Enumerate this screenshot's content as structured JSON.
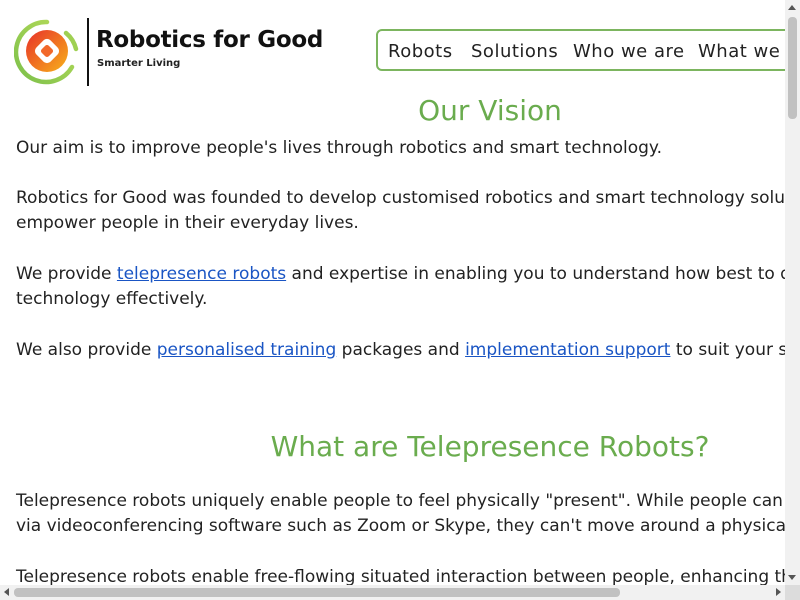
{
  "header": {
    "brand_title": "Robotics for Good",
    "brand_tagline": "Smarter Living",
    "logo_icon": "robotics-logo-icon",
    "nav": [
      {
        "label": "Robots"
      },
      {
        "label": "Solutions"
      },
      {
        "label": "Who we are"
      },
      {
        "label": "What we do"
      }
    ]
  },
  "vision": {
    "heading": "Our Vision",
    "p1": "Our aim is to improve people's lives through robotics and smart technology.",
    "p2_line1": "Robotics for Good was founded to develop customised robotics and smart technology solutions to",
    "p2_line2": "empower people in their everyday lives.",
    "p3_before": "We provide ",
    "p3_link": "telepresence robots",
    "p3_after": " and expertise in enabling you to understand how best to deploy this",
    "p3_line2": "technology effectively.",
    "p4_before": "We also provide ",
    "p4_link1": "personalised training",
    "p4_mid": " packages and ",
    "p4_link2": "implementation support",
    "p4_after": " to suit your specific needs."
  },
  "telepresence": {
    "heading": "What are Telepresence Robots?",
    "p1_line1": "Telepresence robots uniquely enable people to feel physically \"present\". While people can connect",
    "p1_line2": "via videoconferencing software such as Zoom or Skype, they can't move around a physical space.",
    "p2_line1": "Telepresence robots enable free-flowing situated interaction between people, enhancing the social"
  },
  "colors": {
    "accent_green": "#6aac4e",
    "nav_border": "#7cb55f",
    "link_blue": "#1a55c4",
    "text": "#222222"
  }
}
